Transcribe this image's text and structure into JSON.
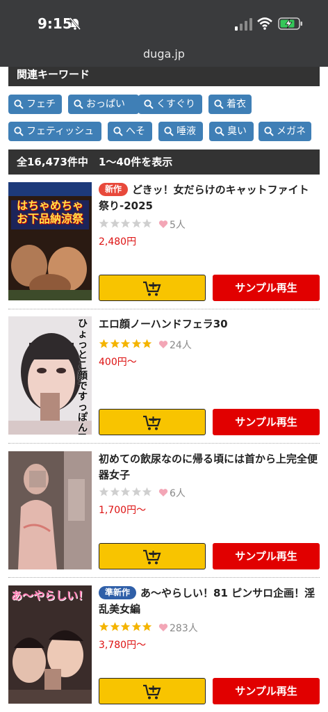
{
  "status": {
    "time": "9:15",
    "url": "duga.jp"
  },
  "keywords": {
    "title": "関連キーワード",
    "tags": [
      "フェチ",
      "おっぱい",
      "くすぐり",
      "着衣",
      "フェティッシュ",
      "へそ",
      "唾液",
      "臭い",
      "メガネ"
    ]
  },
  "results": {
    "summary": "全16,473件中　1〜40件を表示"
  },
  "items": [
    {
      "badge": "新作",
      "title": "どきッ！女だらけのキャットファイト祭り-2025",
      "rating": 0,
      "likes": "5人",
      "price": "2,480円",
      "sample_label": "サンプル再生",
      "thumb_text": "はちゃめちゃお下品納涼祭"
    },
    {
      "badge": "",
      "title": "エロ顔ノーハンドフェラ30",
      "rating": 5,
      "likes": "24人",
      "price": "400円〜",
      "sample_label": "サンプル再生",
      "thumb_text": "ひょっとこ顔ですっぽん吸引"
    },
    {
      "badge": "",
      "title": "初めての飲尿なのに帰る頃には首から上完全便器女子",
      "rating": 0,
      "likes": "6人",
      "price": "1,700円〜",
      "sample_label": "サンプル再生",
      "thumb_text": ""
    },
    {
      "badge": "準新作",
      "title": "あ〜やらしい！81 ピンサロ企画！淫乱美女編",
      "rating": 5,
      "likes": "283人",
      "price": "3,780円〜",
      "sample_label": "サンプル再生",
      "thumb_text": "あ〜やらしい！"
    }
  ],
  "colors": {
    "tag": "#3f7fb6",
    "star_on": "#f4b400",
    "star_off": "#cfcfcf",
    "price": "#dd1111",
    "cart": "#f8c400",
    "sample": "#e10000"
  }
}
